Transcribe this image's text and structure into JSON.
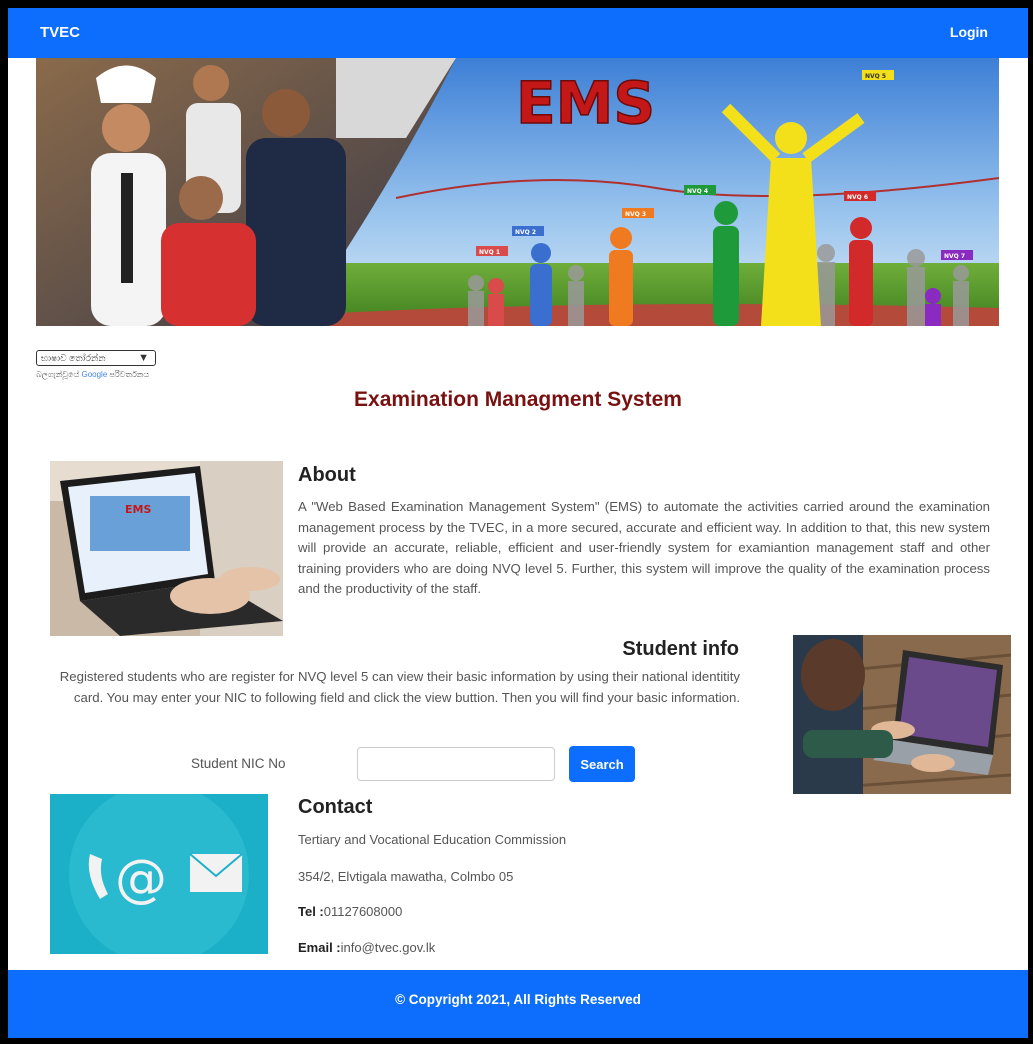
{
  "navbar": {
    "brand": "TVEC",
    "login": "Login"
  },
  "banner": {
    "logo_text": "EMS",
    "flags": [
      "NVQ 1",
      "NVQ 2",
      "NVQ 3",
      "NVQ 4",
      "NVQ 5",
      "NVQ 6",
      "NVQ 7"
    ]
  },
  "translate": {
    "select_value": "භාෂාව තෝරන්න",
    "powered_prefix": "බලගැන්වූයේ",
    "powered_brand": "Google",
    "powered_suffix": "පරිවර්තනය"
  },
  "page_title": "Examination Managment System",
  "about": {
    "title": "About",
    "text": "A \"Web Based Examination Management System\" (EMS) to automate the activities carried around the examination management process by the TVEC, in a more secured, accurate and efficient way. In addition to that, this new system will provide an accurate, reliable, efficient and user-friendly system for examiantion management staff and other training providers who are doing NVQ level 5. Further, this system will improve the quality of the examination process and the productivity of the staff."
  },
  "student_info": {
    "title": "Student info",
    "text": "Registered students who are register for NVQ level 5 can view their basic information by using their national identitity card. You may enter your NIC to following field and click the view buttion. Then you will find your basic information.",
    "nic_label": "Student NIC No",
    "nic_value": "",
    "search_label": "Search"
  },
  "contact": {
    "title": "Contact",
    "org": "Tertiary and Vocational Education Commission",
    "address": "354/2, Elvtigala mawatha, Colmbo 05",
    "tel_label": "Tel :",
    "tel_value": "01127608000",
    "email_label": "Email :",
    "email_value": "info@tvec.gov.lk"
  },
  "footer": {
    "copyright": "© Copyright 2021, All Rights Reserved"
  },
  "colors": {
    "primary": "#0d6efd",
    "title_red": "#7a1111"
  }
}
